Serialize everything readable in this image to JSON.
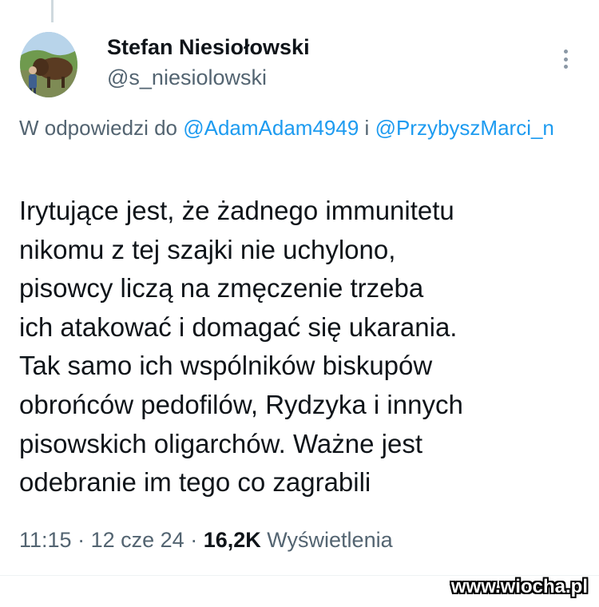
{
  "author": {
    "name": "Stefan Niesiołowski",
    "handle": "@s_niesiolowski"
  },
  "reply": {
    "prefix": "W odpowiedzi do",
    "user1": "@AdamAdam4949",
    "conjunction": "i",
    "user2": "@PrzybyszMarci_n"
  },
  "tweet": {
    "text": "Irytujące jest, że żadnego immunitetu\nnikomu z tej szajki nie uchylono,\npisowcy liczą na zmęczenie trzeba\nich  atakować i domagać się ukarania.\nTak samo ich wspólników biskupów\nobrońców pedofilów, Rydzyka i innych\npisowskich oligarchów. Ważne jest\nodebranie im tego co zagrabili"
  },
  "meta": {
    "time": "11:15",
    "separator": "·",
    "date": "12 cze 24",
    "views_count": "16,2K",
    "views_label": "Wyświetlenia"
  },
  "watermark": "www.wiocha.pl"
}
